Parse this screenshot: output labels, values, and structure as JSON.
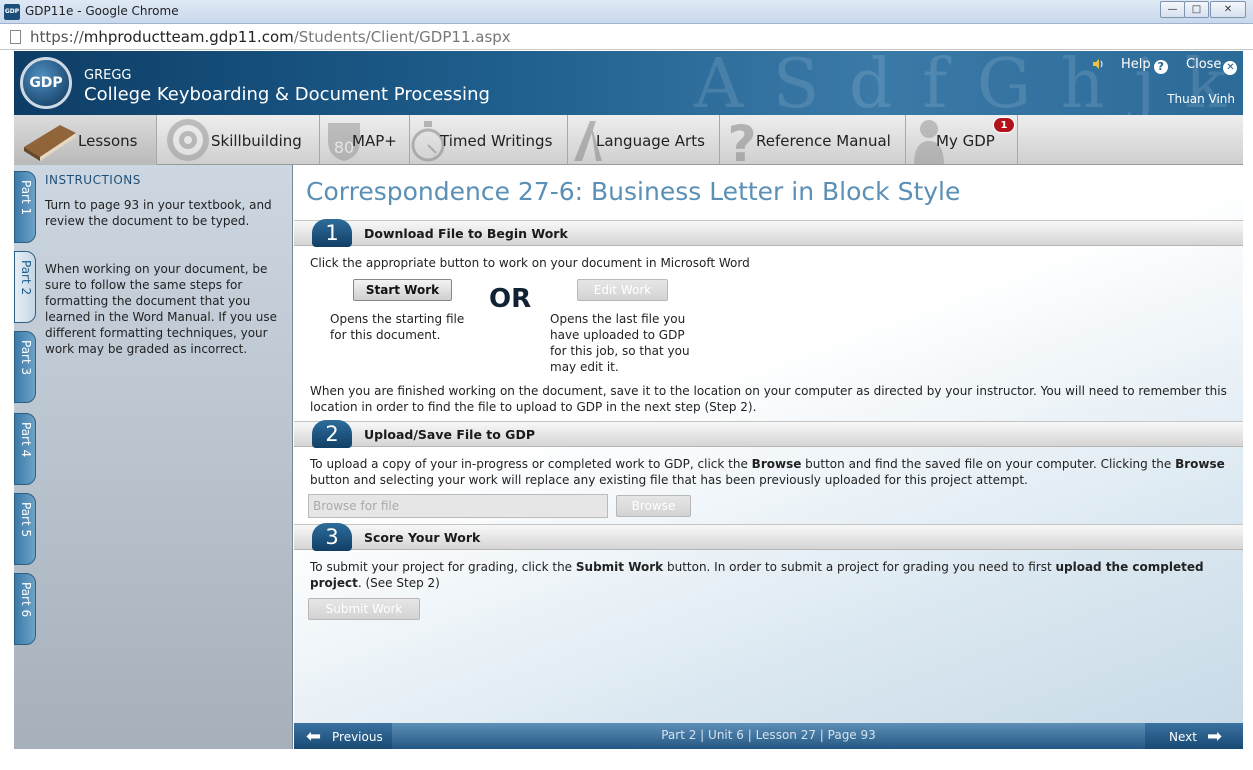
{
  "window": {
    "title": "GDP11e - Google Chrome",
    "app_icon": "GDP",
    "minimize": "—",
    "maximize": "□",
    "close": "✕"
  },
  "address": {
    "scheme": "https://",
    "host": "mhproductteam.gdp11.com",
    "path": "/Students/Client/GDP11.aspx"
  },
  "header": {
    "logo": "GDP",
    "brand_top": "GREGG",
    "brand_main": "College Keyboarding & Document Processing",
    "help_label": "Help",
    "close_label": "Close",
    "user": "Thuan Vinh",
    "bg_letters": "A S d f G h j k L :"
  },
  "nav": {
    "tabs": [
      {
        "label": "Lessons",
        "icon": "book-icon"
      },
      {
        "label": "Skillbuilding",
        "icon": "target-icon"
      },
      {
        "label": "MAP+",
        "icon": "highway-80-icon"
      },
      {
        "label": "Timed Writings",
        "icon": "stopwatch-icon"
      },
      {
        "label": "Language Arts",
        "icon": "letter-a-icon"
      },
      {
        "label": "Reference Manual",
        "icon": "question-icon"
      },
      {
        "label": "My GDP",
        "icon": "person-icon",
        "badge": "1"
      }
    ]
  },
  "parts": [
    "Part 1",
    "Part 2",
    "Part 3",
    "Part 4",
    "Part 5",
    "Part 6"
  ],
  "instructions": {
    "title": "INSTRUCTIONS",
    "p1": "Turn to page 93 in your textbook, and review the document to be typed.",
    "p2": "When working on your document, be sure to follow the same steps for formatting the document that you learned in the Word Manual. If you use different formatting techniques, your work may be graded as incorrect."
  },
  "main": {
    "title": "Correspondence 27-6: Business Letter in Block Style",
    "step1": {
      "num": "1",
      "title": "Download File to Begin Work",
      "intro": "Click the appropriate button to work on your document in Microsoft Word",
      "start_btn": "Start Work",
      "start_desc": "Opens the starting file for this document.",
      "or": "OR",
      "edit_btn": "Edit Work",
      "edit_desc": "Opens the last file you have uploaded to GDP for this job, so that you may edit it.",
      "after": "When you are finished working on the document, save it to the location on your computer as directed by your instructor. You will need to remember this location in order to find the file to upload to GDP in the next step (Step 2)."
    },
    "step2": {
      "num": "2",
      "title": "Upload/Save File to GDP",
      "t1": "To upload a copy of your in-progress or completed work to GDP, click the ",
      "b1": "Browse",
      "t2": " button and find the saved file on your computer. Clicking the ",
      "b2": "Browse",
      "t3": " button and selecting your work will replace any existing file that has been previously uploaded for this project attempt.",
      "placeholder": "Browse for file",
      "browse_btn": "Browse"
    },
    "step3": {
      "num": "3",
      "title": "Score Your Work",
      "t1": "To submit your project for grading, click the ",
      "b1": "Submit Work",
      "t2": " button. In order to submit a project for grading you need to first ",
      "b2": "upload the completed project",
      "t3": ". (See Step 2)",
      "submit_btn": "Submit Work"
    }
  },
  "footer": {
    "prev": "Previous",
    "next": "Next",
    "crumb": "Part 2 | Unit 6 | Lesson 27 | Page 93"
  }
}
